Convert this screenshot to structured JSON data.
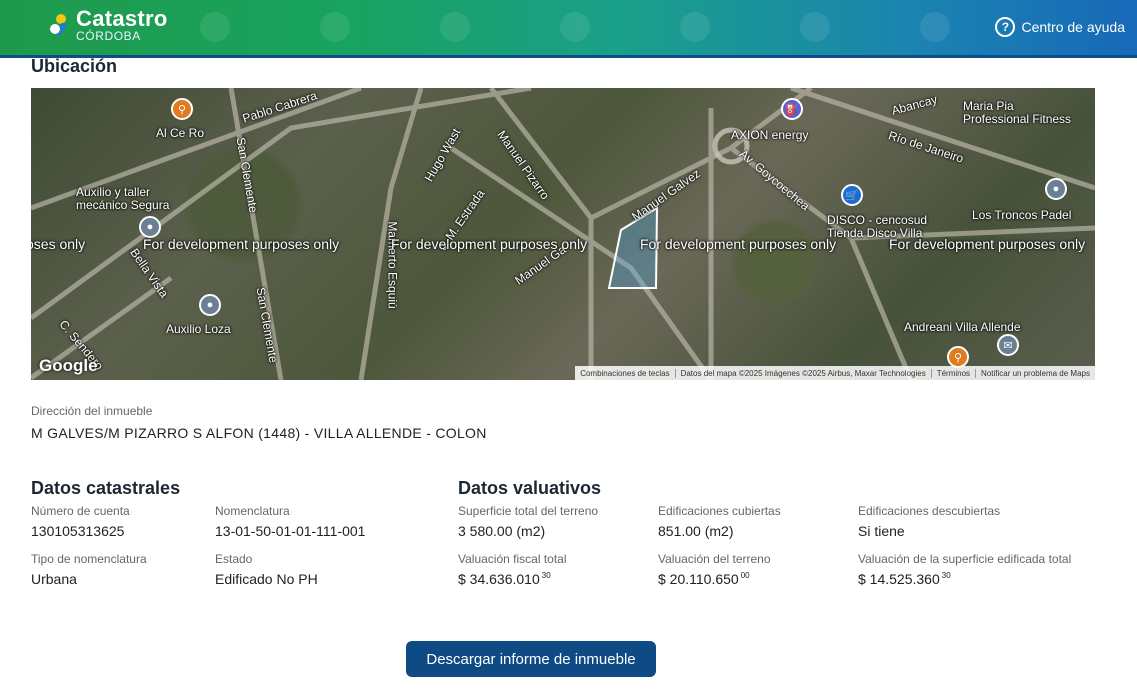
{
  "header": {
    "logo_title": "Catastro",
    "logo_subtitle": "CÓRDOBA",
    "help_label": "Centro de ayuda",
    "gradient_colors": [
      "#1f9a4b",
      "#1b84b0",
      "#1869b8"
    ]
  },
  "location_section": {
    "title": "Ubicación"
  },
  "map": {
    "watermark_left_partial": "oses only",
    "watermark": "For development purposes only",
    "google_label": "Google",
    "street_labels": [
      "Pablo Cabrera",
      "Al Ce Ro",
      "San Clemente",
      "Hugo Wast",
      "Manuel Pizarro",
      "Manuel Galvez",
      "Auxilio y taller\nmecánico Segura",
      "J. M. Estrada",
      "Manuel Ga",
      "Mamerto Esquiú",
      "Bella Vista",
      "Auxilio Loza",
      "San Clemente",
      "C. Sendero",
      "AXION energy",
      "Av. Goycoechea",
      "Abancay",
      "Maria Pia\nProfessional Fitness",
      "Río de Janeiro",
      "DISCO - cencosud\nTienda Disco Villa",
      "Los Troncos Padel",
      "Andreani Villa Allende"
    ],
    "attribution": [
      "Combinaciones de teclas",
      "Datos del mapa ©2025 Imágenes ©2025 Airbus, Maxar Technologies",
      "Términos",
      "Notificar un problema de Maps"
    ]
  },
  "address": {
    "label": "Dirección del inmueble",
    "value": "M GALVES/M PIZARRO S ALFON (1448) - VILLA ALLENDE - COLON"
  },
  "catastral": {
    "title": "Datos catastrales",
    "fields": [
      {
        "label": "Número de cuenta",
        "value": "130105313625"
      },
      {
        "label": "Nomenclatura",
        "value": "13-01-50-01-01-111-001"
      },
      {
        "label": "Tipo de nomenclatura",
        "value": "Urbana"
      },
      {
        "label": "Estado",
        "value": "Edificado No PH"
      }
    ]
  },
  "valuativos": {
    "title": "Datos valuativos",
    "fields": [
      {
        "label": "Superficie total del terreno",
        "value": "3 580.00 (m2)"
      },
      {
        "label": "Edificaciones cubiertas",
        "value": "851.00 (m2)"
      },
      {
        "label": "Edificaciones descubiertas",
        "value": "Si tiene"
      },
      {
        "label": "Valuación fiscal total",
        "value": "$ 34.636.010",
        "cents": "30"
      },
      {
        "label": "Valuación del terreno",
        "value": "$ 20.110.650",
        "cents": "00"
      },
      {
        "label": "Valuación de la superficie edificada total",
        "value": "$ 14.525.360",
        "cents": "30"
      }
    ]
  },
  "actions": {
    "download_label": "Descargar informe de inmueble"
  }
}
